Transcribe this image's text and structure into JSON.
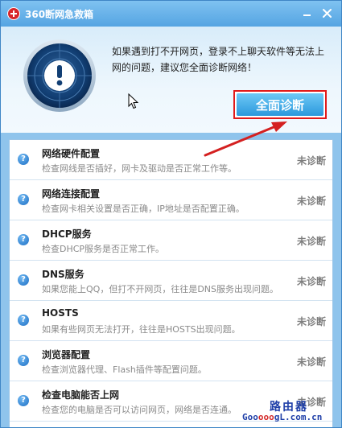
{
  "window": {
    "title": "360断网急救箱",
    "app_icon": "red-cross-icon",
    "buttons": [
      "minimize-icon",
      "close-icon"
    ]
  },
  "header": {
    "message": "如果遇到打不开网页，登录不上聊天软件等无法上网的问题，建议您全面诊断网络！",
    "diagnose_button": "全面诊断"
  },
  "items": [
    {
      "title": "网络硬件配置",
      "desc": "检查网线是否插好，网卡及驱动是否正常工作等。",
      "status": "未诊断"
    },
    {
      "title": "网络连接配置",
      "desc": "检查网卡相关设置是否正确，IP地址是否配置正确。",
      "status": "未诊断"
    },
    {
      "title": "DHCP服务",
      "desc": "检查DHCP服务是否正常工作。",
      "status": "未诊断"
    },
    {
      "title": "DNS服务",
      "desc": "如果您能上QQ，但打不开网页，往往是DNS服务出现问题。",
      "status": "未诊断"
    },
    {
      "title": "HOSTS",
      "desc": "如果有些网页无法打开，往往是HOSTS出现问题。",
      "status": "未诊断"
    },
    {
      "title": "浏览器配置",
      "desc": "检查浏览器代理、Flash插件等配置问题。",
      "status": "未诊断"
    },
    {
      "title": "检查电脑能否上网",
      "desc": "检查您的电脑是否可以访问网页，网络是否连通。",
      "status": "未诊断"
    }
  ],
  "watermark": {
    "top": "路由器",
    "bottom_a": "Goo",
    "bottom_b": "ooo",
    "bottom_c": "gL.com.cn"
  },
  "colors": {
    "title_bar": "#55a4e2",
    "diagnose_button": "#2b98dc",
    "highlight_border": "#e11a1a",
    "annotation_arrow": "#d42020",
    "status_text": "#7d7d7d"
  }
}
